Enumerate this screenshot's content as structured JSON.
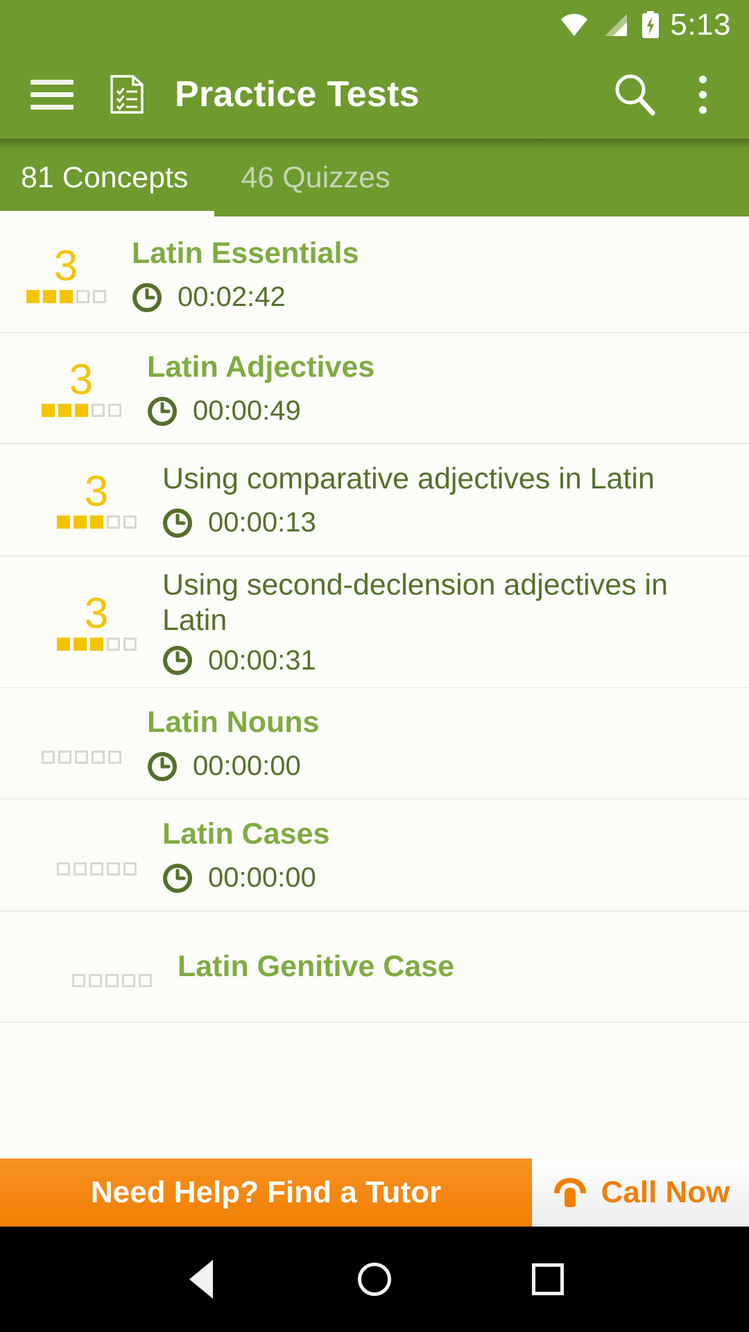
{
  "status_bar": {
    "time": "5:13",
    "icons": [
      "wifi-icon",
      "cellular-signal-icon",
      "battery-charging-icon"
    ]
  },
  "app_bar": {
    "menu_icon": "hamburger-menu-icon",
    "app_icon": "checklist-document-icon",
    "title": "Practice Tests",
    "search_icon": "search-icon",
    "overflow_icon": "more-vertical-icon"
  },
  "tabs": {
    "active_index": 0,
    "items": [
      {
        "label": "81 Concepts",
        "active": true
      },
      {
        "label": "46 Quizzes",
        "active": false
      }
    ]
  },
  "colors": {
    "primary_green": "#6F9A2E",
    "accent_green": "#7FAB42",
    "dark_green": "#55702B",
    "gold": "#F5C400",
    "orange": "#F07F06",
    "list_bg": "#FCFCF8"
  },
  "list": {
    "rows": [
      {
        "rating": "3",
        "filled": 3,
        "total": 5,
        "title": "Latin Essentials",
        "title_style": "accent",
        "time": "00:02:42",
        "clock_icon": "clock-icon"
      },
      {
        "rating": "3",
        "filled": 3,
        "total": 5,
        "title": "Latin Adjectives",
        "title_style": "accent",
        "time": "00:00:49",
        "clock_icon": "clock-icon"
      },
      {
        "rating": "3",
        "filled": 3,
        "total": 5,
        "title": "Using comparative adjectives in Latin",
        "title_style": "plain",
        "time": "00:00:13",
        "clock_icon": "clock-icon"
      },
      {
        "rating": "3",
        "filled": 3,
        "total": 5,
        "title": "Using second-declension adjectives in Latin",
        "title_style": "plain",
        "time": "00:00:31",
        "clock_icon": "clock-icon"
      },
      {
        "rating": "",
        "filled": 0,
        "total": 5,
        "title": "Latin Nouns",
        "title_style": "accent",
        "time": "00:00:00",
        "clock_icon": "clock-icon"
      },
      {
        "rating": "",
        "filled": 0,
        "total": 5,
        "title": "Latin Cases",
        "title_style": "accent",
        "time": "00:00:00",
        "clock_icon": "clock-icon"
      },
      {
        "rating": "",
        "filled": 0,
        "total": 5,
        "title": "Latin Genitive Case",
        "title_style": "accent",
        "time": "",
        "clock_icon": "clock-icon"
      }
    ]
  },
  "banner": {
    "tutor_label": "Need Help? Find a Tutor",
    "call_label": "Call Now",
    "call_icon": "telephone-icon"
  },
  "nav_bar": {
    "back": "back-triangle-icon",
    "home": "home-circle-icon",
    "recents": "recents-square-icon"
  }
}
